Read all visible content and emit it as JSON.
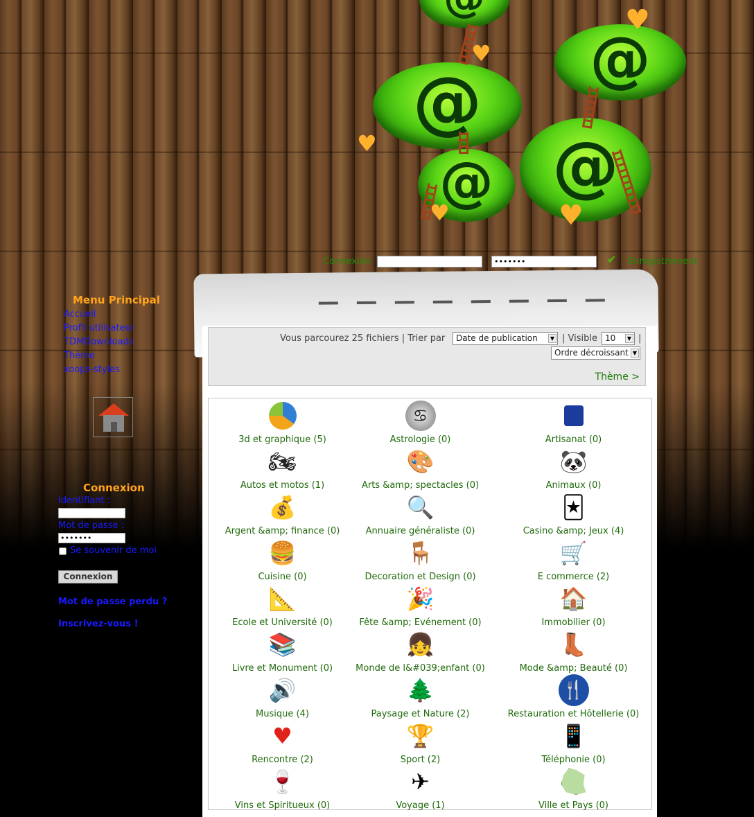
{
  "header": {
    "login_label": "Connexion",
    "login_password_value": "•••••••",
    "register_label": "Enregistrement"
  },
  "sidebar": {
    "menu_title": "Menu Principal",
    "menu_items": [
      "Accueil",
      "Profil utilisateur",
      "TDMDownloads",
      "Thème",
      "xoops-styles"
    ],
    "login": {
      "title": "Connexion",
      "username_label": "Identifiant :",
      "password_label": "Mot de passe :",
      "password_value": "•••••••",
      "remember_label": "Se souvenir de moi",
      "submit_label": "Connexion",
      "lost_password": "Mot de passe perdu ?",
      "register": "Inscrivez-vous !"
    }
  },
  "toolbar": {
    "browse_text": "Vous parcourez 25 fichiers | Trier par",
    "sort_value": "Date de publication",
    "visible_label": "| Visible",
    "visible_value": "10",
    "pipe": "|",
    "order_value": "Ordre décroissant",
    "theme_link": "Thème >"
  },
  "categories": [
    {
      "label": "3d et graphique (5)",
      "icon": "pie-chart-icon"
    },
    {
      "label": "Astrologie (0)",
      "icon": "crab-zodiac-icon"
    },
    {
      "label": "Artisanat (0)",
      "icon": "artisan-logo-icon"
    },
    {
      "label": "Autos et motos (1)",
      "icon": "motorbike-icon"
    },
    {
      "label": "Arts &amp; spectacles (0)",
      "icon": "palette-icon"
    },
    {
      "label": "Animaux (0)",
      "icon": "panda-icon"
    },
    {
      "label": "Argent &amp; finance (0)",
      "icon": "money-icon"
    },
    {
      "label": "Annuaire généraliste (0)",
      "icon": "magnifier-icon"
    },
    {
      "label": "Casino &amp; Jeux (4)",
      "icon": "playing-cards-icon"
    },
    {
      "label": "Cuisine (0)",
      "icon": "burger-icon"
    },
    {
      "label": "Decoration et Design (0)",
      "icon": "design-chair-icon"
    },
    {
      "label": "E commerce (2)",
      "icon": "shopping-cart-icon"
    },
    {
      "label": "Ecole et Université (0)",
      "icon": "drawing-tools-icon"
    },
    {
      "label": "Fête &amp; Evénement (0)",
      "icon": "party-hat-icon"
    },
    {
      "label": "Immobilier (0)",
      "icon": "house-icon"
    },
    {
      "label": "Livre et Monument (0)",
      "icon": "books-icon"
    },
    {
      "label": "Monde de l&#039;enfant (0)",
      "icon": "child-icon"
    },
    {
      "label": "Mode &amp; Beauté (0)",
      "icon": "boot-icon"
    },
    {
      "label": "Musique (4)",
      "icon": "speaker-icon"
    },
    {
      "label": "Paysage et Nature (2)",
      "icon": "trees-icon"
    },
    {
      "label": "Restauration et Hôtellerie (0)",
      "icon": "cutlery-icon"
    },
    {
      "label": "Rencontre (2)",
      "icon": "heart-icon"
    },
    {
      "label": "Sport (2)",
      "icon": "trophy-icon"
    },
    {
      "label": "Téléphonie (0)",
      "icon": "mobile-phone-icon"
    },
    {
      "label": "Vins et Spiritueux (0)",
      "icon": "wine-glass-icon"
    },
    {
      "label": "Voyage (1)",
      "icon": "airplane-icon"
    },
    {
      "label": "Ville et Pays (0)",
      "icon": "france-map-icon"
    }
  ]
}
